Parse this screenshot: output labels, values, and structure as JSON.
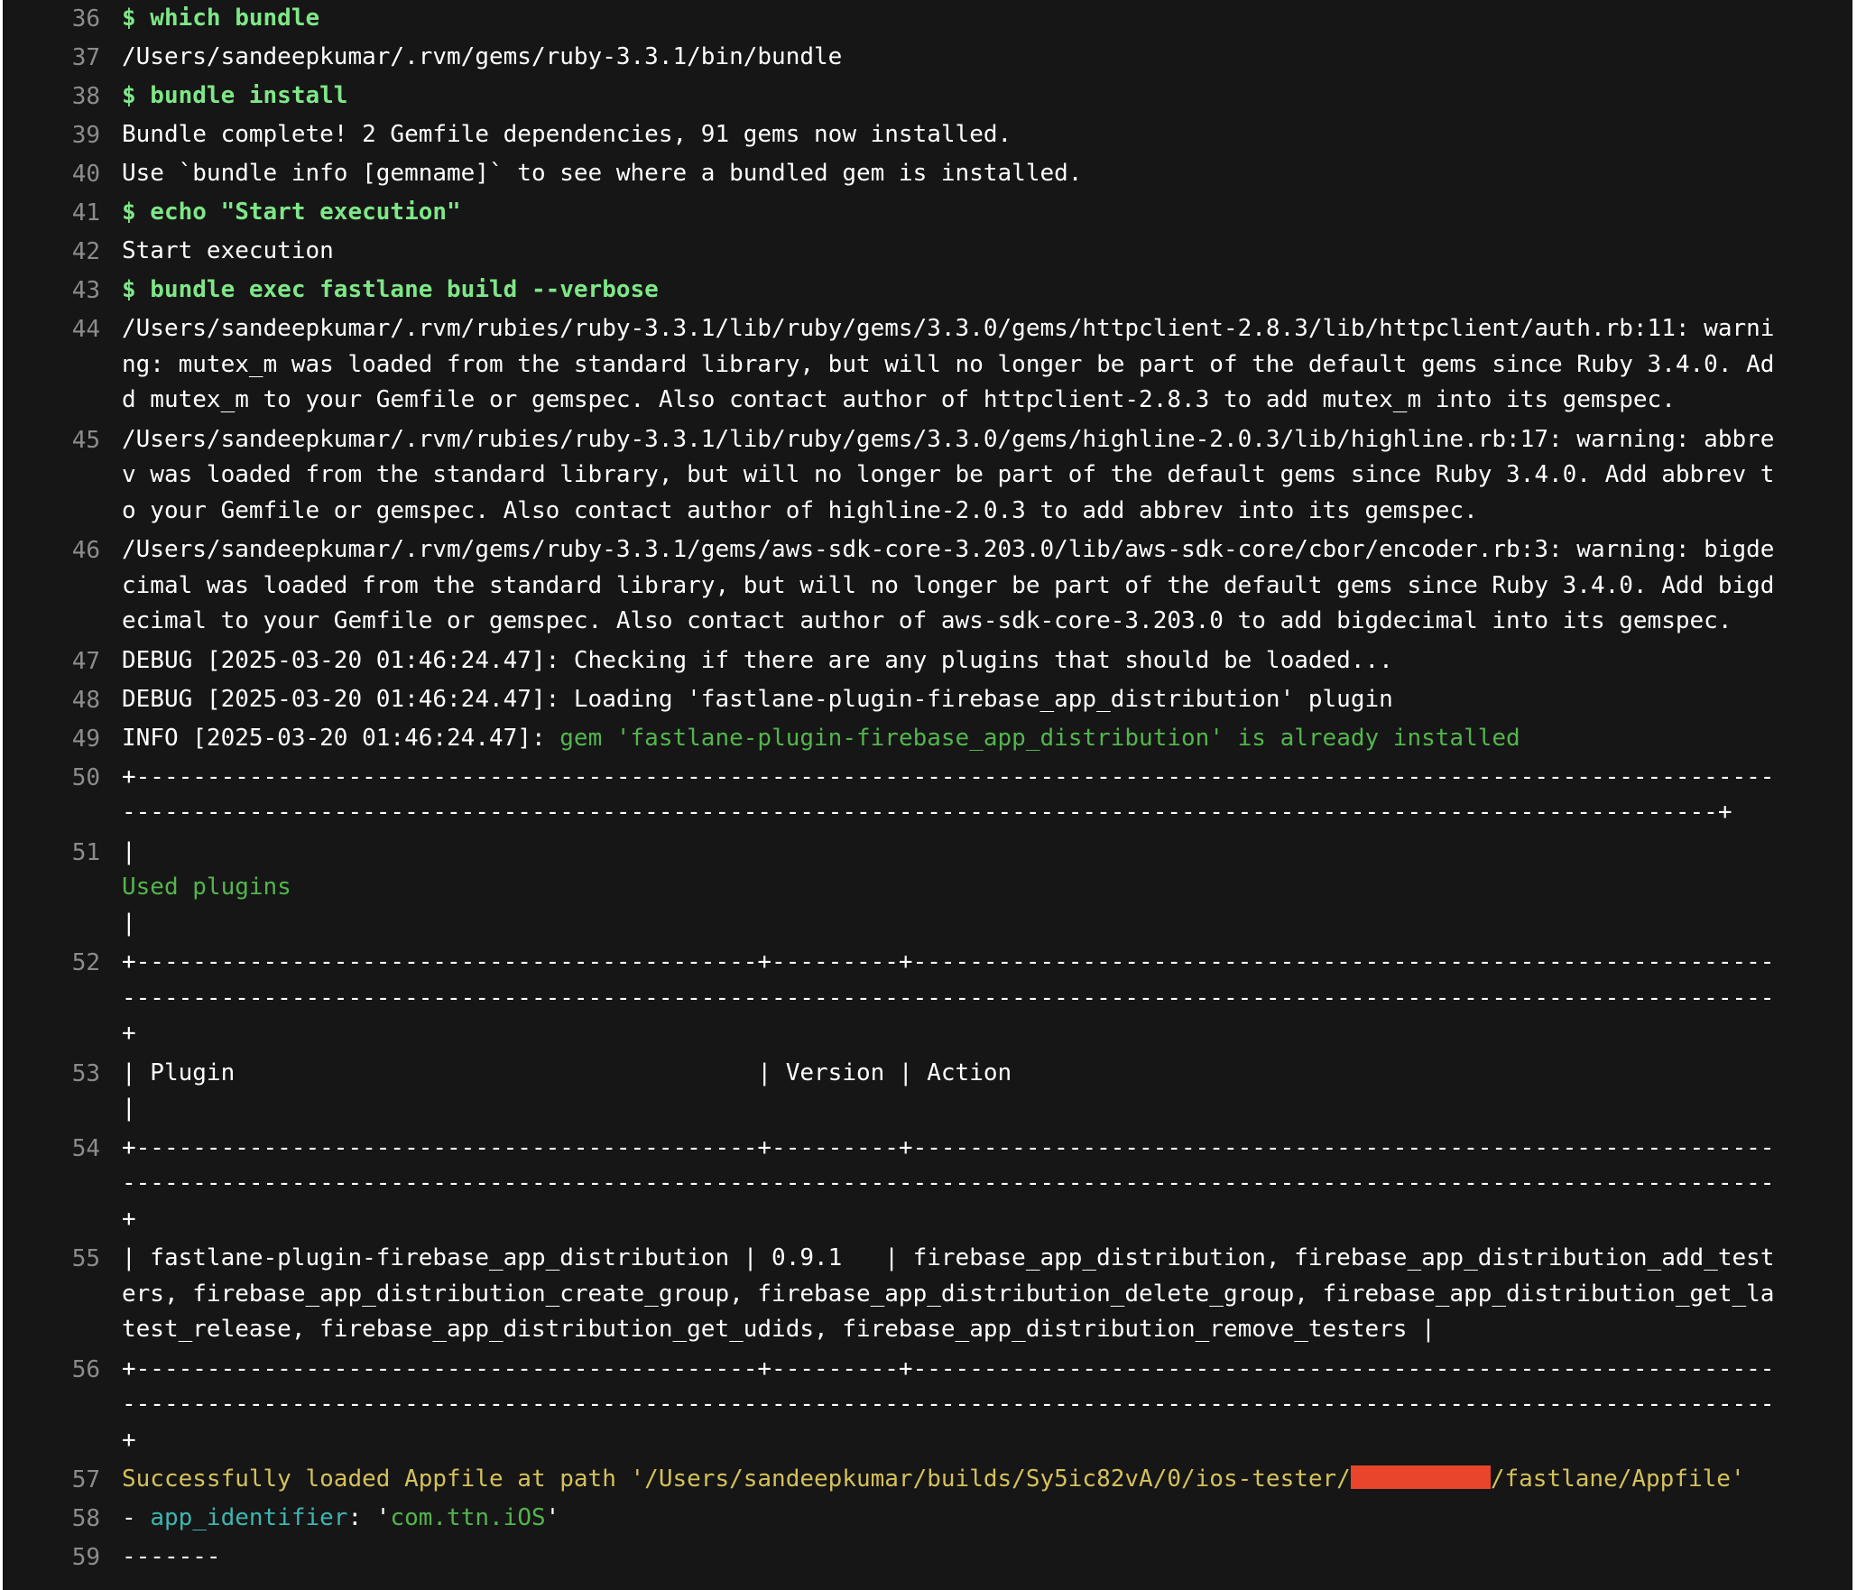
{
  "log": {
    "lines": [
      {
        "num": "36",
        "text": "$ which bundle"
      },
      {
        "num": "37",
        "text": "/Users/sandeepkumar/.rvm/gems/ruby-3.3.1/bin/bundle"
      },
      {
        "num": "38",
        "text": "$ bundle install"
      },
      {
        "num": "39",
        "text": "Bundle complete! 2 Gemfile dependencies, 91 gems now installed."
      },
      {
        "num": "40",
        "text": "Use `bundle info [gemname]` to see where a bundled gem is installed."
      },
      {
        "num": "41",
        "text": "$ echo \"Start execution\""
      },
      {
        "num": "42",
        "text": "Start execution"
      },
      {
        "num": "43",
        "text": "$ bundle exec fastlane build --verbose"
      },
      {
        "num": "44",
        "text": "/Users/sandeepkumar/.rvm/rubies/ruby-3.3.1/lib/ruby/gems/3.3.0/gems/httpclient-2.8.3/lib/httpclient/auth.rb:11: warning: mutex_m was loaded from the standard library, but will no longer be part of the default gems since Ruby 3.4.0. Add mutex_m to your Gemfile or gemspec. Also contact author of httpclient-2.8.3 to add mutex_m into its gemspec."
      },
      {
        "num": "45",
        "text": "/Users/sandeepkumar/.rvm/rubies/ruby-3.3.1/lib/ruby/gems/3.3.0/gems/highline-2.0.3/lib/highline.rb:17: warning: abbrev was loaded from the standard library, but will no longer be part of the default gems since Ruby 3.4.0. Add abbrev to your Gemfile or gemspec. Also contact author of highline-2.0.3 to add abbrev into its gemspec."
      },
      {
        "num": "46",
        "text": "/Users/sandeepkumar/.rvm/gems/ruby-3.3.1/gems/aws-sdk-core-3.203.0/lib/aws-sdk-core/cbor/encoder.rb:3: warning: bigdecimal was loaded from the standard library, but will no longer be part of the default gems since Ruby 3.4.0. Add bigdecimal to your Gemfile or gemspec. Also contact author of aws-sdk-core-3.203.0 to add bigdecimal into its gemspec."
      },
      {
        "num": "47",
        "text": "DEBUG [2025-03-20 01:46:24.47]: Checking if there are any plugins that should be loaded..."
      },
      {
        "num": "48",
        "text": "DEBUG [2025-03-20 01:46:24.47]: Loading 'fastlane-plugin-firebase_app_distribution' plugin"
      },
      {
        "num": "49",
        "prefix": "INFO [2025-03-20 01:46:24.47]: ",
        "text": "gem 'fastlane-plugin-firebase_app_distribution' is already installed"
      },
      {
        "num": "50",
        "text": "+-------------------------------------------------------------------------------------------------------------------------------------------------------------------------------------------------------------------------------------+"
      },
      {
        "num": "51",
        "pre": "|",
        "text": "Used plugins",
        "post": "|"
      },
      {
        "num": "52",
        "text": "+--------------------------------------------+---------+----------------------------------------------------------------------------------------------------------------------------------------------------------------------------------+"
      },
      {
        "num": "53",
        "text": "| Plugin                                     | Version | Action                                                                                                                                                                           |"
      },
      {
        "num": "54",
        "text": "+--------------------------------------------+---------+----------------------------------------------------------------------------------------------------------------------------------------------------------------------------------+"
      },
      {
        "num": "55",
        "text": "| fastlane-plugin-firebase_app_distribution | 0.9.1   | firebase_app_distribution, firebase_app_distribution_add_testers, firebase_app_distribution_create_group, firebase_app_distribution_delete_group, firebase_app_distribution_get_latest_release, firebase_app_distribution_get_udids, firebase_app_distribution_remove_testers |"
      },
      {
        "num": "56",
        "text": "+--------------------------------------------+---------+----------------------------------------------------------------------------------------------------------------------------------------------------------------------------------+"
      },
      {
        "num": "57",
        "before": "Successfully loaded Appfile at path '/Users/sandeepkumar/builds/Sy5ic82vA/0/ios-tester/",
        "after": "/fastlane/Appfile'"
      },
      {
        "num": "58",
        "dash": "- ",
        "key": "app_identifier",
        "colon": ": '",
        "value": "com.ttn.iOS",
        "quote": "'"
      },
      {
        "num": "59",
        "text": "-------"
      }
    ]
  },
  "colors": {
    "background": "#161616",
    "line_number": "#8c8c8c",
    "command": "#7ee787",
    "info_green": "#53b54d",
    "appfile_yellow": "#d4c15a",
    "identifier_teal": "#3eb5b0",
    "redaction": "#e8452a"
  }
}
